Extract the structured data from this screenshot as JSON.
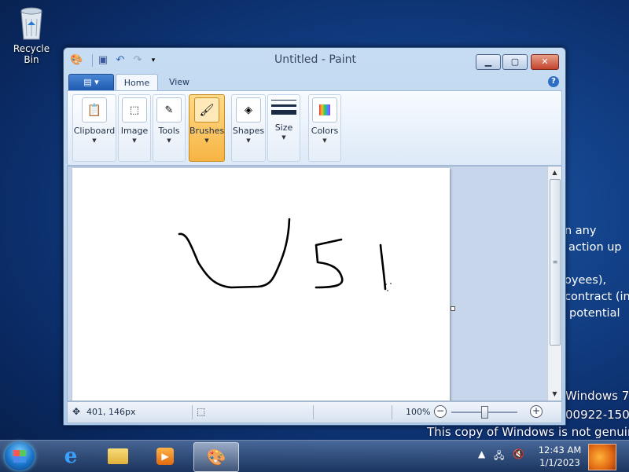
{
  "desktop": {
    "recycle_bin_label": "Recycle Bin",
    "background_text": [
      "n any",
      "action up",
      "oyees),",
      "contract (in",
      "potential"
    ]
  },
  "watermark": {
    "line1": "Windows 7",
    "line2": "00922-1508",
    "line3": "This copy of Windows is not genuine"
  },
  "paint": {
    "title": "Untitled - Paint",
    "tabs": [
      "Home",
      "View"
    ],
    "active_tab": "Home",
    "groups": [
      {
        "label": "Clipboard",
        "icon": "clipboard-icon"
      },
      {
        "label": "Image",
        "icon": "image-select-icon"
      },
      {
        "label": "Tools",
        "icon": "tools-icon"
      },
      {
        "label": "Brushes",
        "icon": "brush-icon",
        "selected": true
      },
      {
        "label": "Shapes",
        "icon": "shapes-icon"
      },
      {
        "label": "Size",
        "icon": "size-icon"
      },
      {
        "label": "Colors",
        "icon": "colors-icon"
      }
    ],
    "status": {
      "cursor_position": "401, 146px",
      "zoom": "100%"
    }
  },
  "taskbar": {
    "apps": [
      "internet-explorer",
      "windows-explorer",
      "media-player",
      "paint"
    ],
    "active_app": "paint",
    "clock_time": "12:43 AM",
    "clock_date": "1/1/2023"
  }
}
